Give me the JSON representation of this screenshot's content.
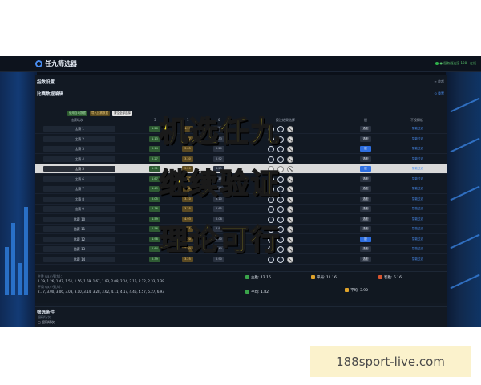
{
  "app": {
    "title": "任九筛选器",
    "status": "●  服务器连接 128 · 在线"
  },
  "sections": {
    "params_title": "指数设置",
    "params_right": "≡ 收起",
    "match_edit_title": "比赛数据编辑",
    "match_edit_right": "⟲ 重置",
    "tags": [
      "使用自动数据",
      "导入比赛数据",
      "清空全部选择"
    ]
  },
  "table": {
    "headers": [
      "比赛场次",
      "3",
      "1",
      "0",
      "投注结果选择",
      "胆",
      "不投解析"
    ],
    "rows": [
      {
        "name": "比赛 1",
        "o1": "1.26",
        "o2": "4.17",
        "o3": "1.10",
        "pill": "选胆",
        "pill_blue": false,
        "link": "智能过滤"
      },
      {
        "name": "比赛 2",
        "o1": "1.13",
        "o2": "2.47",
        "o3": "1.33",
        "pill": "选胆",
        "pill_blue": false,
        "link": "智能过滤"
      },
      {
        "name": "比赛 3",
        "o1": "2.14",
        "o2": "3.05",
        "o3": "2.20",
        "pill": "胆",
        "pill_blue": true,
        "link": "智能过滤"
      },
      {
        "name": "比赛 4",
        "o1": "2.27",
        "o2": "3.30",
        "o3": "2.92",
        "pill": "选胆",
        "pill_blue": false,
        "link": "智能过滤"
      },
      {
        "name": "比赛 5",
        "o1": "1.91",
        "o2": "3.20",
        "o3": "4.25",
        "pill": "胆",
        "pill_blue": true,
        "link": "智能过滤"
      },
      {
        "name": "比赛 6",
        "o1": "1.67",
        "o2": "3.42",
        "o3": "2.19",
        "pill": "选胆",
        "pill_blue": false,
        "link": "智能过滤"
      },
      {
        "name": "比赛 7",
        "o1": "1.49",
        "o2": "3.80",
        "o3": "4.65",
        "pill": "选胆",
        "pill_blue": false,
        "link": "智能过滤"
      },
      {
        "name": "比赛 8",
        "o1": "2.05",
        "o2": "3.10",
        "o3": "3.10",
        "pill": "选胆",
        "pill_blue": false,
        "link": "智能过滤"
      },
      {
        "name": "比赛 9",
        "o1": "2.36",
        "o2": "3.25",
        "o3": "2.65",
        "pill": "选胆",
        "pill_blue": false,
        "link": "智能过滤"
      },
      {
        "name": "比赛 10",
        "o1": "1.59",
        "o2": "4.93",
        "o3": "2.08",
        "pill": "选胆",
        "pill_blue": false,
        "link": "智能过滤"
      },
      {
        "name": "比赛 11",
        "o1": "1.56",
        "o2": "4.11",
        "o3": "4.90",
        "pill": "选胆",
        "pill_blue": false,
        "link": "智能过滤"
      },
      {
        "name": "比赛 12",
        "o1": "1.98",
        "o2": "3.20",
        "o3": "3.30",
        "pill": "胆",
        "pill_blue": true,
        "link": "智能过滤"
      },
      {
        "name": "比赛 13",
        "o1": "1.64",
        "o2": "3.60",
        "o3": "4.40",
        "pill": "选胆",
        "pill_blue": false,
        "link": "智能过滤"
      },
      {
        "name": "比赛 14",
        "o1": "2.39",
        "o2": "3.25",
        "o3": "2.90",
        "pill": "选胆",
        "pill_blue": false,
        "link": "智能过滤"
      }
    ]
  },
  "summary": {
    "label1": "主胜 (从小到大)：",
    "line1": "1.19, 1.26, 1.47, 1.51, 1.56, 1.59, 1.67, 1.93, 2.08, 2.14, 2.16, 2.22, 2.33, 2.39",
    "label2": "平局 (从小到大)：",
    "line2": "2.77, 3.00, 3.06, 3.08, 3.10, 3.14, 3.28, 3.62, 4.11, 4.17, 4.46, 4.57, 5.27, 6.93",
    "stat_home": "主胜: 12.16",
    "stat_draw": "平局: 11.16",
    "stat_away": "客胜: 5.16",
    "stat_avg1": "平均: 1.82",
    "stat_avg2": "平均: 3.90"
  },
  "filter": {
    "title": "筛选条件",
    "sub": "胆码场次",
    "sub2": "□ 胆码场次",
    "rule_title": "预型场数筛选",
    "rule_left": "初期场数: 7      至: 7         ☑ 启用",
    "rule_right": "次阶场数: 2      至: 2         ☑ 启用"
  },
  "captions": [
    "机选任九",
    "继续验证",
    "理论可行"
  ],
  "watermark": "188sport-live.com",
  "colors": {
    "caption": "#f2df2b",
    "accent_blue": "#2f6fe0",
    "odd_green": "#2e5a33",
    "odd_orange": "#5b4a22"
  }
}
